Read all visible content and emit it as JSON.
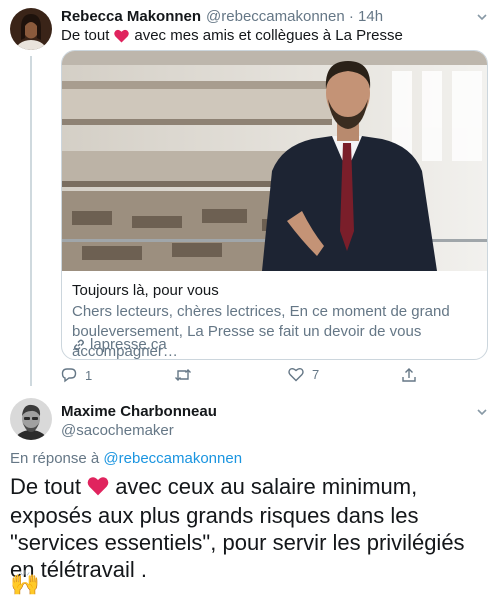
{
  "tweet1": {
    "name": "Rebecca Makonnen",
    "handle": "@rebeccamakonnen · 14h",
    "text_before": "De tout",
    "text_after": "avec mes amis et collègues à La Presse",
    "card": {
      "title": "Toujours là, pour vous",
      "description": "Chers lecteurs, chères lectrices, En ce moment de grand bouleversement, La Presse se fait un devoir de vous accompagner…",
      "link": "lapresse.ca"
    },
    "actions": {
      "reply_count": "1",
      "retweet_count": "",
      "like_count": "7"
    }
  },
  "tweet2": {
    "name": "Maxime Charbonneau",
    "handle": "@sacochemaker",
    "reply_prefix": "En réponse à",
    "reply_handle": "@rebeccamakonnen",
    "text_before": "De tout",
    "text_after": "avec ceux au salaire minimum, exposés aux plus grands risques dans les \"services essentiels\", pour servir les privilégiés en télétravail .",
    "emoji": "🙌"
  },
  "colors": {
    "heart": "#e0245e",
    "link": "#1b95e0",
    "muted": "#657786"
  },
  "icons": [
    "chevron-down-icon",
    "heart-icon",
    "link-icon",
    "reply-icon",
    "retweet-icon",
    "like-icon",
    "share-icon"
  ]
}
